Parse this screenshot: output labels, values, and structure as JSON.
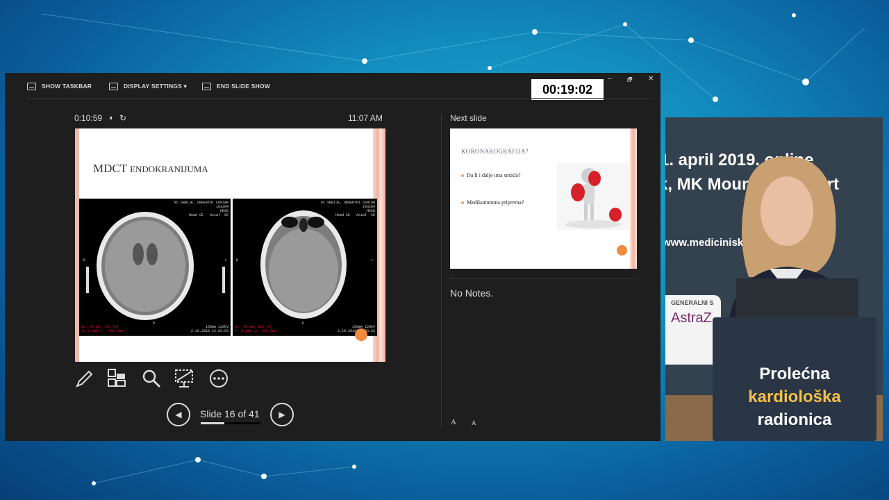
{
  "toolbar": {
    "show_taskbar": "SHOW TASKBAR",
    "display_settings": "DISPLAY SETTINGS ▾",
    "end_slide_show": "END SLIDE SHOW",
    "timer": "00:19:02",
    "minimize": "–",
    "restore": "🗗",
    "close": "✕"
  },
  "status": {
    "elapsed": "0:10:59",
    "pause_icon": "⏸",
    "reset_icon": "↻",
    "clock": "11:07 AM"
  },
  "current_slide": {
    "title_main": "MDCT ",
    "title_small": "ENDOKRANIJUMA",
    "ct_left": {
      "header": "KC SRBIJE, URGENTNI CENTAR\n103284\nHEAD\nHead CE   Axial  CE",
      "footer_left": "WL: 40 WW: 100 [D]\nT: 5.0mm L: -450.0mm",
      "footer_right": "150mA 120kV\n2.10.2018 12:03:53",
      "marker_r": "R",
      "marker_l": "L",
      "marker_p": "P"
    },
    "ct_right": {
      "header": "KC SRBIJE, URGENTNI CENTAR\n103284\nHEAD\nHead CE   Axial  CE",
      "footer_left": "WL: 40 WW: 120 [D]\nT: 5.0mm L: -465.0mm",
      "footer_right": "150mA 120kV\n2.10.2018 12:03:53",
      "marker_r": "R",
      "marker_l": "L",
      "marker_p": "P"
    }
  },
  "tools": {
    "pen": "pen-icon",
    "all_slides": "grid-icon",
    "zoom": "magnifier-icon",
    "black_screen": "screen-icon",
    "more": "more-icon"
  },
  "navigation": {
    "prev": "◀",
    "next": "▶",
    "slide_count": "Slide 16 of 41",
    "progress": 0.39
  },
  "next_slide": {
    "label": "Next slide",
    "title": "KORONAROGRAFIJA?",
    "bullet1": "Da li i dalje ima smisla?",
    "bullet2": "Medikamentna priprema?"
  },
  "notes": {
    "text": "No Notes.",
    "increase": "A",
    "decrease": "A"
  },
  "video": {
    "banner_line1": "1. april 2019. online",
    "banner_line2": "k, MK Mountain Resort",
    "banner_url": "www.mediciniskaradionica",
    "sponsor_label": "GENERALNI S",
    "sponsor_brand": "AstraZ",
    "podium_line1": "Prolećna",
    "podium_line2": "kardiološka",
    "podium_line3": "radionica",
    "accent": "#f5c04a"
  }
}
